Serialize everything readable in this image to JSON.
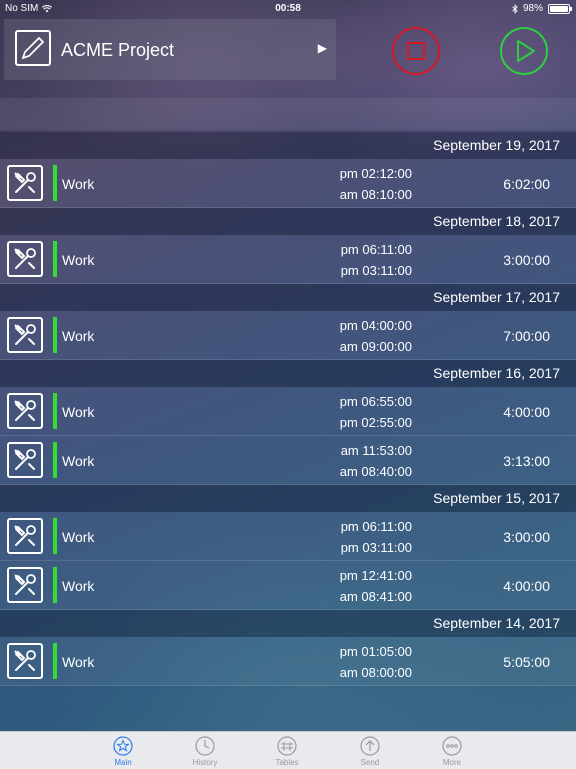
{
  "status_bar": {
    "carrier": "No SIM",
    "time": "00:58",
    "battery": "98%",
    "battery_level": 0.98
  },
  "project": {
    "title": "ACME Project"
  },
  "colors": {
    "stop": "#d01a2a",
    "start": "#2ecc40",
    "entry_bar": "#33dd33",
    "tab_active": "#2f7bea"
  },
  "days": [
    {
      "date": "September 19, 2017",
      "entries": [
        {
          "label": "Work",
          "end": "pm 02:12:00",
          "start": "am 08:10:00",
          "duration": "6:02:00"
        }
      ]
    },
    {
      "date": "September 18, 2017",
      "entries": [
        {
          "label": "Work",
          "end": "pm 06:11:00",
          "start": "pm 03:11:00",
          "duration": "3:00:00"
        }
      ]
    },
    {
      "date": "September 17, 2017",
      "entries": [
        {
          "label": "Work",
          "end": "pm 04:00:00",
          "start": "am 09:00:00",
          "duration": "7:00:00"
        }
      ]
    },
    {
      "date": "September 16, 2017",
      "entries": [
        {
          "label": "Work",
          "end": "pm 06:55:00",
          "start": "pm 02:55:00",
          "duration": "4:00:00"
        },
        {
          "label": "Work",
          "end": "am 11:53:00",
          "start": "am 08:40:00",
          "duration": "3:13:00"
        }
      ]
    },
    {
      "date": "September 15, 2017",
      "entries": [
        {
          "label": "Work",
          "end": "pm 06:11:00",
          "start": "pm 03:11:00",
          "duration": "3:00:00"
        },
        {
          "label": "Work",
          "end": "pm 12:41:00",
          "start": "am 08:41:00",
          "duration": "4:00:00"
        }
      ]
    },
    {
      "date": "September 14, 2017",
      "entries": [
        {
          "label": "Work",
          "end": "pm 01:05:00",
          "start": "am 08:00:00",
          "duration": "5:05:00"
        }
      ]
    }
  ],
  "tabs": [
    {
      "label": "Main",
      "icon": "star-icon",
      "active": true
    },
    {
      "label": "History",
      "icon": "clock-icon",
      "active": false
    },
    {
      "label": "Tables",
      "icon": "table-icon",
      "active": false
    },
    {
      "label": "Send",
      "icon": "send-icon",
      "active": false
    },
    {
      "label": "More",
      "icon": "more-icon",
      "active": false
    }
  ]
}
